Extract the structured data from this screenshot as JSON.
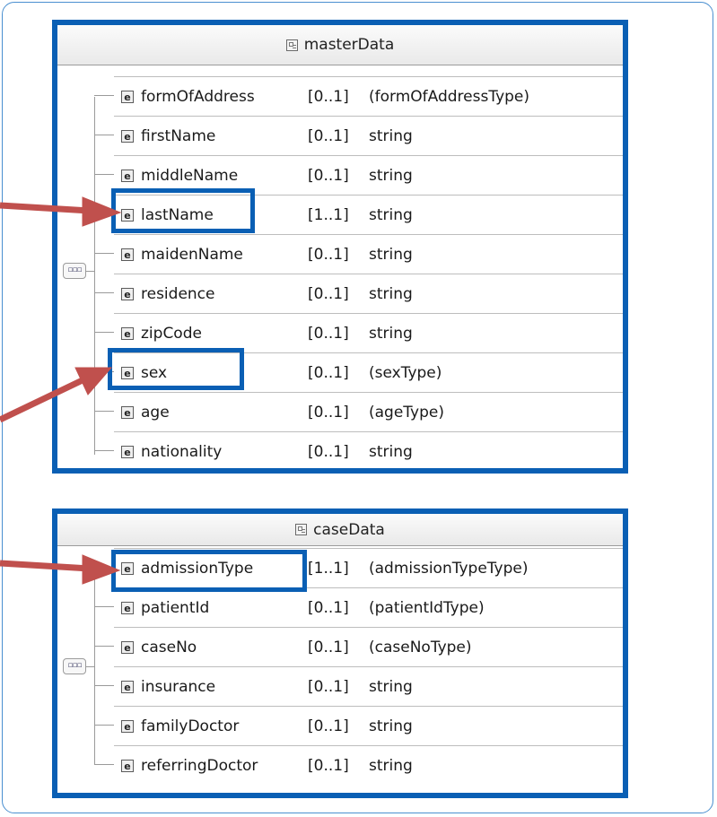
{
  "panels": {
    "master": {
      "title": "masterData",
      "seq_icon": "▫▫▫",
      "rows": [
        {
          "name": "formOfAddress",
          "mult": "[0..1]",
          "type": "(formOfAddressType)"
        },
        {
          "name": "firstName",
          "mult": "[0..1]",
          "type": "string"
        },
        {
          "name": "middleName",
          "mult": "[0..1]",
          "type": "string"
        },
        {
          "name": "lastName",
          "mult": "[1..1]",
          "type": "string"
        },
        {
          "name": "maidenName",
          "mult": "[0..1]",
          "type": "string"
        },
        {
          "name": "residence",
          "mult": "[0..1]",
          "type": "string"
        },
        {
          "name": "zipCode",
          "mult": "[0..1]",
          "type": "string"
        },
        {
          "name": "sex",
          "mult": "[0..1]",
          "type": "(sexType)"
        },
        {
          "name": "age",
          "mult": "[0..1]",
          "type": "(ageType)"
        },
        {
          "name": "nationality",
          "mult": "[0..1]",
          "type": "string"
        }
      ]
    },
    "case": {
      "title": "caseData",
      "seq_icon": "▫▫▫",
      "rows": [
        {
          "name": "admissionType",
          "mult": "[1..1]",
          "type": "(admissionTypeType)"
        },
        {
          "name": "patientId",
          "mult": "[0..1]",
          "type": "(patientIdType)"
        },
        {
          "name": "caseNo",
          "mult": "[0..1]",
          "type": "(caseNoType)"
        },
        {
          "name": "insurance",
          "mult": "[0..1]",
          "type": "string"
        },
        {
          "name": "familyDoctor",
          "mult": "[0..1]",
          "type": "string"
        },
        {
          "name": "referringDoctor",
          "mult": "[0..1]",
          "type": "string"
        }
      ]
    }
  },
  "element_icon_letter": "e",
  "colors": {
    "highlight": "#0a5fb4",
    "arrow": "#c0504d"
  }
}
